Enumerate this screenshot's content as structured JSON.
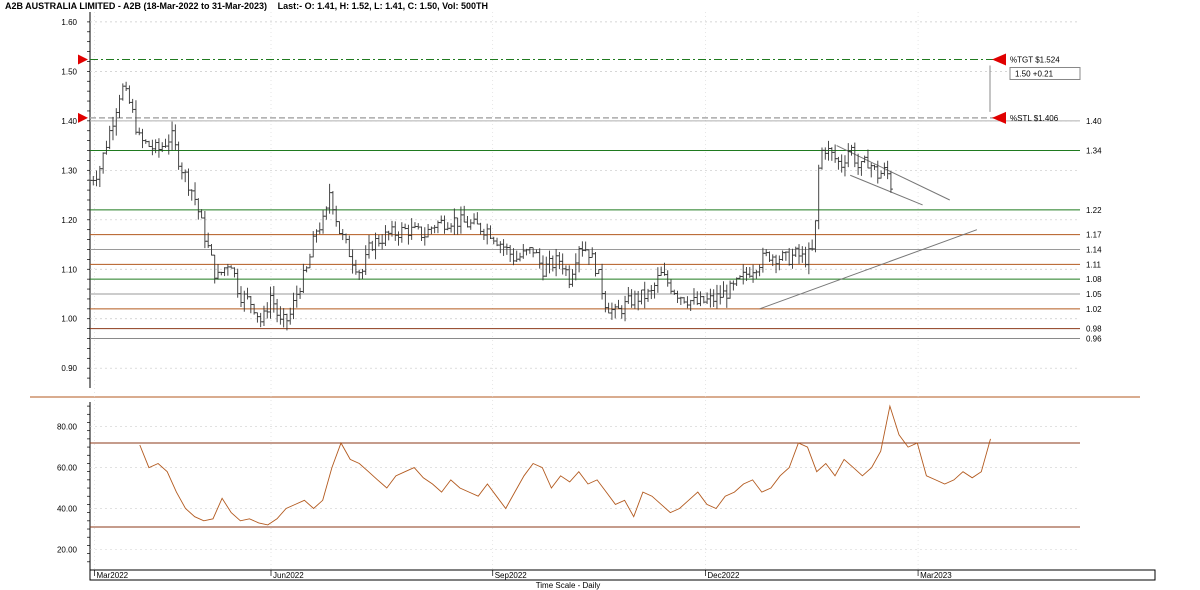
{
  "header": {
    "title": "A2B AUSTRALIA LIMITED - A2B (18-Mar-2022 to 31-Mar-2023)",
    "last": "Last:- O: 1.41, H: 1.52, L: 1.41, C: 1.50, Vol: 500TH"
  },
  "chart_data": [
    {
      "type": "bar",
      "subtype": "ohlc",
      "ylim": [
        0.86,
        1.62
      ],
      "grid": true,
      "ytick_labels": [
        "1.60",
        "1.50",
        "1.40",
        "1.30",
        "1.20",
        "1.10",
        "1.00",
        "0.90"
      ],
      "ytick_values": [
        1.6,
        1.5,
        1.4,
        1.3,
        1.2,
        1.1,
        1.0,
        0.9
      ],
      "xtick_labels": [
        "Mar2022",
        "Jun2022",
        "Sep2022",
        "Dec2022",
        "Mar2023"
      ],
      "xlabel": "Time Scale - Daily",
      "price_path": [
        [
          "Mar2022",
          1.28
        ],
        [
          0.01,
          1.3
        ],
        [
          0.025,
          1.4
        ],
        [
          0.035,
          1.47
        ],
        [
          0.045,
          1.43
        ],
        [
          0.055,
          1.36
        ],
        [
          0.075,
          1.34
        ],
        [
          0.09,
          1.37
        ],
        [
          0.1,
          1.31
        ],
        [
          0.115,
          1.25
        ],
        [
          0.125,
          1.18
        ],
        [
          0.14,
          1.08
        ],
        [
          0.155,
          1.12
        ],
        [
          0.165,
          1.05
        ],
        [
          0.18,
          1.03
        ],
        [
          0.19,
          0.99
        ],
        [
          0.2,
          1.05
        ],
        [
          0.21,
          0.99
        ],
        [
          0.22,
          1.0
        ],
        [
          0.23,
          1.06
        ],
        [
          0.24,
          1.1
        ],
        [
          0.25,
          1.18
        ],
        [
          0.26,
          1.2
        ],
        [
          0.265,
          1.26
        ],
        [
          0.275,
          1.18
        ],
        [
          0.29,
          1.12
        ],
        [
          0.3,
          1.09
        ],
        [
          0.31,
          1.15
        ],
        [
          0.33,
          1.17
        ],
        [
          0.35,
          1.18
        ],
        [
          0.37,
          1.17
        ],
        [
          0.38,
          1.19
        ],
        [
          0.4,
          1.2
        ],
        [
          0.42,
          1.19
        ],
        [
          0.44,
          1.18
        ],
        [
          0.45,
          1.16
        ],
        [
          0.47,
          1.12
        ],
        [
          0.49,
          1.14
        ],
        [
          0.5,
          1.1
        ],
        [
          0.52,
          1.12
        ],
        [
          0.53,
          1.08
        ],
        [
          0.54,
          1.15
        ],
        [
          0.55,
          1.14
        ],
        [
          0.56,
          1.1
        ],
        [
          0.57,
          1.03
        ],
        [
          0.58,
          1.01
        ],
        [
          0.6,
          1.04
        ],
        [
          0.62,
          1.05
        ],
        [
          0.63,
          1.09
        ],
        [
          0.64,
          1.07
        ],
        [
          0.65,
          1.05
        ],
        [
          0.67,
          1.03
        ],
        [
          0.69,
          1.04
        ],
        [
          0.71,
          1.06
        ],
        [
          0.73,
          1.1
        ],
        [
          0.75,
          1.13
        ],
        [
          0.77,
          1.12
        ],
        [
          0.78,
          1.13
        ],
        [
          0.79,
          1.12
        ],
        [
          0.8,
          1.14
        ],
        [
          0.805,
          1.3
        ],
        [
          0.81,
          1.35
        ],
        [
          0.82,
          1.33
        ],
        [
          0.83,
          1.31
        ],
        [
          0.84,
          1.35
        ],
        [
          0.85,
          1.3
        ],
        [
          0.86,
          1.32
        ],
        [
          0.87,
          1.29
        ],
        [
          0.88,
          1.3
        ],
        [
          0.885,
          1.27
        ]
      ],
      "horizontal_lines": [
        {
          "label": "1.40",
          "value": 1.4,
          "color": "#b0b0b0"
        },
        {
          "label": "1.34",
          "value": 1.34,
          "color": "#1f7a1f"
        },
        {
          "label": "1.22",
          "value": 1.22,
          "color": "#1f7a1f"
        },
        {
          "label": "1.17",
          "value": 1.17,
          "color": "#b35a1f"
        },
        {
          "label": "1.14",
          "value": 1.14,
          "color": "#9a9a9a"
        },
        {
          "label": "1.11",
          "value": 1.11,
          "color": "#b35a1f"
        },
        {
          "label": "1.08",
          "value": 1.08,
          "color": "#1f7a1f"
        },
        {
          "label": "1.05",
          "value": 1.05,
          "color": "#9a9a9a"
        },
        {
          "label": "1.02",
          "value": 1.02,
          "color": "#b35a1f"
        },
        {
          "label": "0.98",
          "value": 0.98,
          "color": "#8b3a1a"
        },
        {
          "label": "0.96",
          "value": 0.96,
          "color": "#8a8a8a"
        }
      ],
      "markers": {
        "target_label": "%TGT $1.524",
        "target_value": 1.524,
        "stop_label": "%STL $1.406",
        "stop_value": 1.406,
        "change_label": "1.50 +0.21",
        "color": "#e00000"
      },
      "trendlines": [
        {
          "from": [
            0.74,
            1.02
          ],
          "to": [
            0.98,
            1.18
          ],
          "color": "#777777"
        },
        {
          "from": [
            0.825,
            1.35
          ],
          "to": [
            0.95,
            1.24
          ],
          "color": "#777777"
        },
        {
          "from": [
            0.84,
            1.29
          ],
          "to": [
            0.92,
            1.23
          ],
          "color": "#777777"
        }
      ]
    },
    {
      "type": "line",
      "name": "",
      "ylim": [
        10,
        92
      ],
      "ytick_labels": [
        "80.00",
        "60.00",
        "40.00",
        "20.00"
      ],
      "ytick_values": [
        80,
        60,
        40,
        20
      ],
      "bands": [
        72,
        31
      ],
      "color": "#b35a1f",
      "band_color": "#8b3a1a",
      "values": [
        71,
        60,
        62,
        58,
        48,
        40,
        36,
        34,
        35,
        45,
        38,
        34,
        35,
        33,
        32,
        35,
        40,
        42,
        44,
        40,
        44,
        60,
        72,
        64,
        62,
        58,
        54,
        50,
        56,
        58,
        60,
        55,
        52,
        48,
        54,
        50,
        48,
        46,
        52,
        46,
        40,
        48,
        56,
        62,
        60,
        50,
        56,
        53,
        58,
        52,
        54,
        48,
        42,
        44,
        36,
        48,
        46,
        42,
        38,
        40,
        44,
        48,
        42,
        40,
        46,
        48,
        52,
        54,
        48,
        50,
        56,
        60,
        72,
        70,
        58,
        62,
        56,
        64,
        60,
        56,
        60,
        68,
        90,
        76,
        70,
        72,
        56,
        54,
        52,
        54,
        58,
        55,
        58,
        74
      ]
    }
  ]
}
